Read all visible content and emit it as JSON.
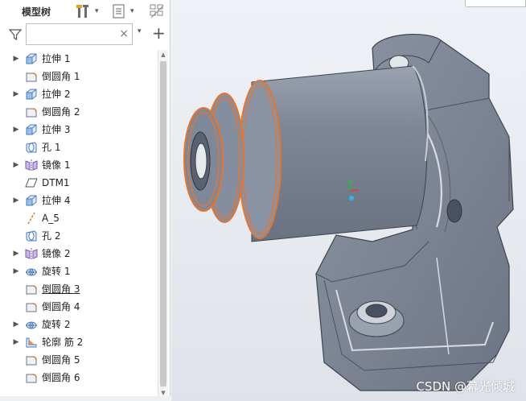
{
  "panel": {
    "title": "模型树",
    "search": {
      "value": "",
      "placeholder": ""
    },
    "clear_glyph": "×",
    "add_glyph": "+",
    "dropdown_glyph": "▾"
  },
  "tree": {
    "items": [
      {
        "label": "拉伸 1",
        "icon": "extrude-icon",
        "expandable": true,
        "underline": false
      },
      {
        "label": "倒圆角 1",
        "icon": "round-icon",
        "expandable": false,
        "underline": false
      },
      {
        "label": "拉伸 2",
        "icon": "extrude-icon",
        "expandable": true,
        "underline": false
      },
      {
        "label": "倒圆角 2",
        "icon": "round-icon",
        "expandable": false,
        "underline": false
      },
      {
        "label": "拉伸 3",
        "icon": "extrude-icon",
        "expandable": true,
        "underline": false
      },
      {
        "label": "孔 1",
        "icon": "hole-icon",
        "expandable": false,
        "underline": false
      },
      {
        "label": "镜像 1",
        "icon": "mirror-icon",
        "expandable": true,
        "underline": false
      },
      {
        "label": "DTM1",
        "icon": "datum-plane-icon",
        "expandable": false,
        "underline": false
      },
      {
        "label": "拉伸 4",
        "icon": "extrude-icon",
        "expandable": true,
        "underline": false
      },
      {
        "label": "A_5",
        "icon": "datum-axis-icon",
        "expandable": false,
        "underline": false
      },
      {
        "label": "孔 2",
        "icon": "hole-icon",
        "expandable": false,
        "underline": false
      },
      {
        "label": "镜像 2",
        "icon": "mirror-icon",
        "expandable": true,
        "underline": false
      },
      {
        "label": "旋转 1",
        "icon": "revolve-icon",
        "expandable": true,
        "underline": false
      },
      {
        "label": "倒圆角 3",
        "icon": "round-icon",
        "expandable": false,
        "underline": true
      },
      {
        "label": "倒圆角 4",
        "icon": "round-icon",
        "expandable": false,
        "underline": false
      },
      {
        "label": "旋转 2",
        "icon": "revolve-icon",
        "expandable": true,
        "underline": false
      },
      {
        "label": "轮廓 筋 2",
        "icon": "profile-rib-icon",
        "expandable": true,
        "underline": false
      },
      {
        "label": "倒圆角 5",
        "icon": "round-icon",
        "expandable": false,
        "underline": false
      },
      {
        "label": "倒圆角 6",
        "icon": "round-icon",
        "expandable": false,
        "underline": false
      }
    ]
  },
  "viewport": {
    "watermark": "CSDN @幕光倾城",
    "highlight_color": "#e8742c",
    "model_color": "#8a93a3"
  }
}
